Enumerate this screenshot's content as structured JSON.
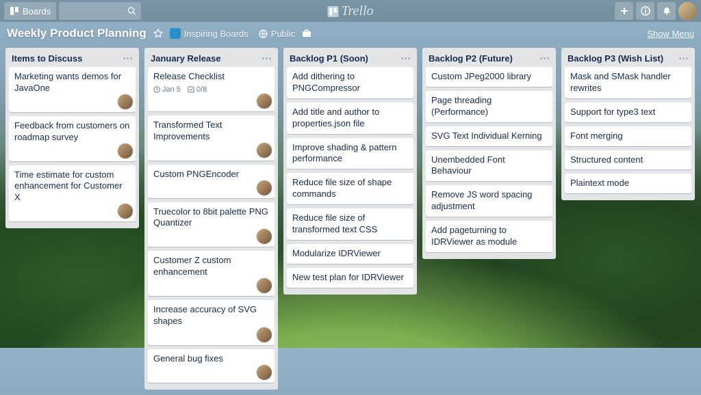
{
  "header": {
    "boards_button": "Boards",
    "search_placeholder": "",
    "brand": "Trello"
  },
  "board_bar": {
    "title": "Weekly Product Planning",
    "team": "Inspiring Boards",
    "team_count": "",
    "visibility": "Public",
    "show_menu": "Show Menu"
  },
  "lists": [
    {
      "title": "Items to Discuss",
      "cards": [
        {
          "title": "Marketing wants demos for JavaOne",
          "member": true
        },
        {
          "title": "Feedback from customers on roadmap survey",
          "member": true
        },
        {
          "title": "Time estimate for custom enhancement for Customer X",
          "member": true
        }
      ]
    },
    {
      "title": "January Release",
      "cards": [
        {
          "title": "Release Checklist",
          "date": "Jan 5",
          "checklist": "0/8",
          "member": true
        },
        {
          "title": "Transformed Text Improvements",
          "member": true
        },
        {
          "title": "Custom PNGEncoder",
          "member": true
        },
        {
          "title": "Truecolor to 8bit palette PNG Quantizer",
          "member": true
        },
        {
          "title": "Customer Z custom enhancement",
          "member": true
        },
        {
          "title": "Increase accuracy of SVG shapes",
          "member": true
        },
        {
          "title": "General bug fixes",
          "member": true
        }
      ]
    },
    {
      "title": "Backlog P1 (Soon)",
      "cards": [
        {
          "title": "Add dithering to PNGCompressor"
        },
        {
          "title": "Add title and author to properties.json file"
        },
        {
          "title": "Improve shading & pattern performance"
        },
        {
          "title": "Reduce file size of shape commands"
        },
        {
          "title": "Reduce file size of transformed text CSS"
        },
        {
          "title": "Modularize IDRViewer"
        },
        {
          "title": "New test plan for IDRViewer"
        }
      ]
    },
    {
      "title": "Backlog P2 (Future)",
      "cards": [
        {
          "title": "Custom JPeg2000 library"
        },
        {
          "title": "Page threading (Performance)"
        },
        {
          "title": "SVG Text Individual Kerning"
        },
        {
          "title": "Unembedded Font Behaviour"
        },
        {
          "title": "Remove JS word spacing adjustment"
        },
        {
          "title": "Add pageturning to IDRViewer as module"
        }
      ]
    },
    {
      "title": "Backlog P3 (Wish List)",
      "cards": [
        {
          "title": "Mask and SMask handler rewrites"
        },
        {
          "title": "Support for type3 text"
        },
        {
          "title": "Font merging"
        },
        {
          "title": "Structured content"
        },
        {
          "title": "Plaintext mode"
        }
      ]
    }
  ]
}
